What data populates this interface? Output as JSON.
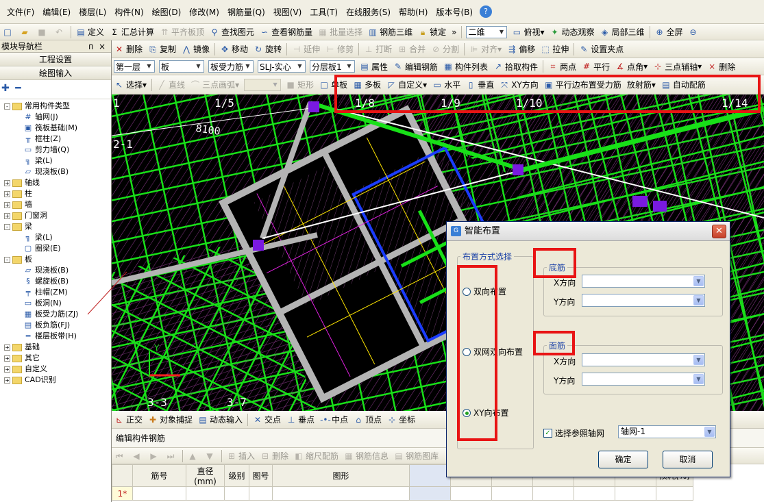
{
  "menu": [
    "文件(F)",
    "编辑(E)",
    "楼层(L)",
    "构件(N)",
    "绘图(D)",
    "修改(M)",
    "钢筋量(Q)",
    "视图(V)",
    "工具(T)",
    "在线服务(S)",
    "帮助(H)",
    "版本号(B)"
  ],
  "toolbar1": {
    "define": "定义",
    "sum": "汇总计算",
    "align_top": "平齐板顶",
    "find": "查找图元",
    "view_rebar": "查看钢筋量",
    "batch_select": "批量选择",
    "rebar_3d": "钢筋三维",
    "lock": "锁定",
    "view_mode": "二维",
    "top_view": "俯视",
    "dynamic_view": "动态观察",
    "local_3d": "局部三维",
    "fullscreen": "全屏"
  },
  "nav": {
    "title": "模块导航栏",
    "pin": "ᴨ",
    "close": "×",
    "section1": "工程设置",
    "section2": "绘图输入",
    "tools": "+  -",
    "tree": [
      {
        "level": 0,
        "expand": "-",
        "label": "常用构件类型"
      },
      {
        "level": 1,
        "icon": "#",
        "label": "轴网(J)"
      },
      {
        "level": 1,
        "icon": "▣",
        "label": "筏板基础(M)"
      },
      {
        "level": 1,
        "icon": "╥",
        "label": "框柱(Z)"
      },
      {
        "level": 1,
        "icon": "▭",
        "label": "剪力墙(Q)"
      },
      {
        "level": 1,
        "icon": "╗",
        "label": "梁(L)"
      },
      {
        "level": 1,
        "icon": "▱",
        "label": "现浇板(B)"
      },
      {
        "level": 0,
        "expand": "+",
        "label": "轴线"
      },
      {
        "level": 0,
        "expand": "+",
        "label": "柱"
      },
      {
        "level": 0,
        "expand": "+",
        "label": "墙"
      },
      {
        "level": 0,
        "expand": "+",
        "label": "门窗洞"
      },
      {
        "level": 0,
        "expand": "-",
        "label": "梁"
      },
      {
        "level": 1,
        "icon": "╗",
        "label": "梁(L)"
      },
      {
        "level": 1,
        "icon": "▢",
        "label": "圈梁(E)"
      },
      {
        "level": 0,
        "expand": "-",
        "label": "板"
      },
      {
        "level": 1,
        "icon": "▱",
        "label": "现浇板(B)"
      },
      {
        "level": 1,
        "icon": "§",
        "label": "螺旋板(B)"
      },
      {
        "level": 1,
        "icon": "╤",
        "label": "柱帽(ZM)"
      },
      {
        "level": 1,
        "icon": "▭",
        "label": "板洞(N)"
      },
      {
        "level": 1,
        "icon": "▦",
        "label": "板受力筋(ZJ)"
      },
      {
        "level": 1,
        "icon": "▤",
        "label": "板负筋(FJ)"
      },
      {
        "level": 1,
        "icon": "═",
        "label": "楼层板带(H)"
      },
      {
        "level": 0,
        "expand": "+",
        "label": "基础"
      },
      {
        "level": 0,
        "expand": "+",
        "label": "其它"
      },
      {
        "level": 0,
        "expand": "+",
        "label": "自定义"
      },
      {
        "level": 0,
        "expand": "+",
        "label": "CAD识别"
      }
    ]
  },
  "toolbar2": {
    "delete": "删除",
    "copy": "复制",
    "mirror": "镜像",
    "move": "移动",
    "rotate": "旋转",
    "extend": "延伸",
    "trim": "修剪",
    "break": "打断",
    "merge": "合并",
    "split": "分割",
    "align": "对齐",
    "offset": "偏移",
    "stretch": "拉伸",
    "set_grip": "设置夹点"
  },
  "toolbar3": {
    "floor": "第一层",
    "type": "板",
    "component": "板受力筋",
    "name": "SLJ-实心",
    "layer": "分层板1",
    "property": "属性",
    "edit_rebar": "编辑钢筋",
    "list": "构件列表",
    "pick": "拾取构件",
    "two_point": "两点",
    "parallel": "平行",
    "point_angle": "点角",
    "three_point": "三点辅轴",
    "delete_aux": "删除"
  },
  "toolbar4": {
    "select": "选择",
    "line": "直线",
    "arc": "三点画弧",
    "rect": "矩形",
    "single": "单板",
    "multi": "多板",
    "custom": "自定义",
    "horizontal": "水平",
    "vertical": "垂直",
    "xy": "XY方向",
    "parallel_edge": "平行边布置受力筋",
    "radial": "放射筋",
    "auto": "自动配筋"
  },
  "cad": {
    "labels": [
      "1",
      "1/5",
      "1/8",
      "1/9",
      "1/10",
      "1/14",
      "2-1",
      "8100",
      "3-3",
      "3-7",
      "Y"
    ]
  },
  "snapbar": {
    "ortho": "正交",
    "snap": "对象捕捉",
    "dyn": "动态输入",
    "intersect": "交点",
    "perp": "垂点",
    "mid": "中点",
    "vertex": "顶点",
    "coord": "坐标"
  },
  "edit_panel": {
    "title": "编辑构件钢筋",
    "insert": "插入",
    "delete": "删除",
    "scale": "缩尺配筋",
    "info": "钢筋信息",
    "lib": "钢筋图库",
    "columns": [
      "筋号",
      "直径(mm)",
      "级别",
      "图号",
      "图形",
      "",
      "",
      "",
      "",
      "",
      "",
      "损耗(%)"
    ],
    "row": "1*"
  },
  "dialog": {
    "title": "智能布置",
    "group_mode": "布置方式选择",
    "opt1": "双向布置",
    "opt2": "双网双向布置",
    "opt3": "XY向布置",
    "bottom": "底筋",
    "top": "面筋",
    "x_dir": "X方向",
    "y_dir": "Y方向",
    "ref_axis": "选择参照轴网",
    "axis_value": "轴网-1",
    "ok": "确定",
    "cancel": "取消"
  }
}
